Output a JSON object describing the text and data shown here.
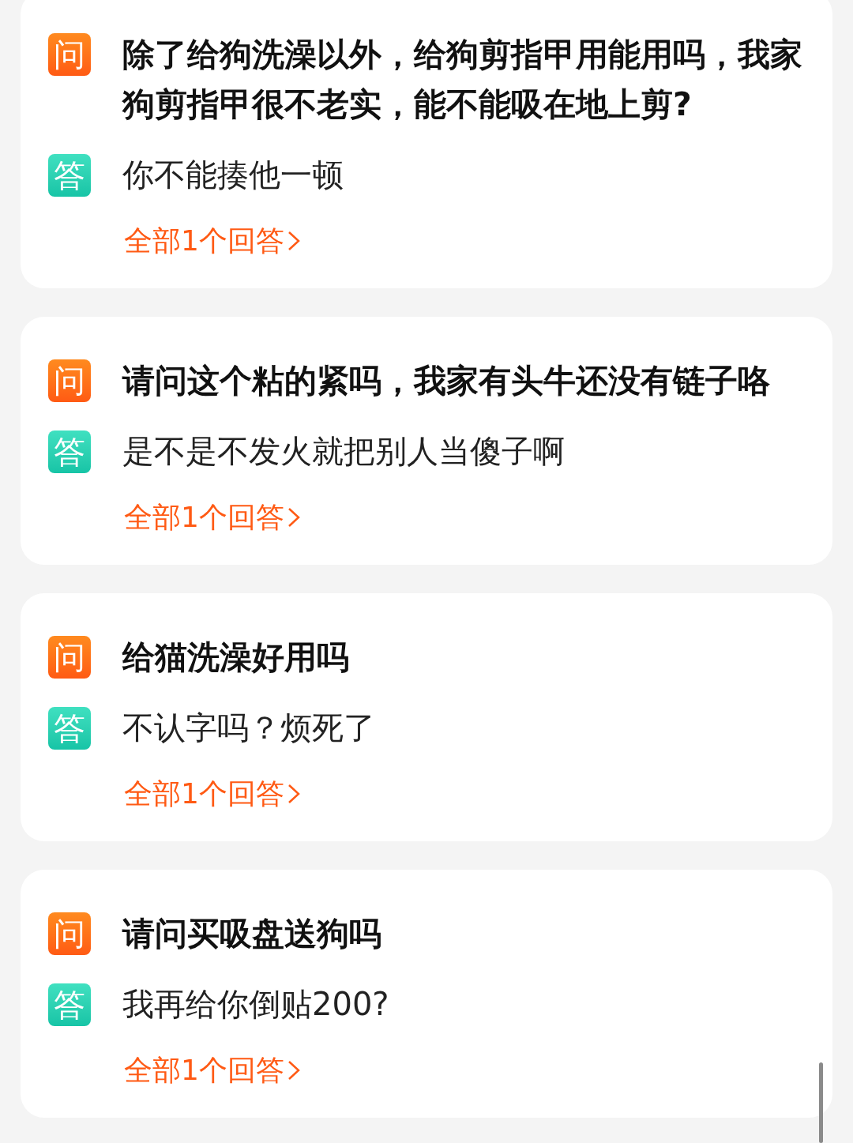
{
  "qa_cards": [
    {
      "question_badge": "问",
      "question": "除了给狗洗澡以外，给狗剪指甲用能用吗，我家狗剪指甲很不老实，能不能吸在地上剪?",
      "answer_badge": "答",
      "answer": "你不能揍他一顿",
      "all_answers_link": "全部1个回答"
    },
    {
      "question_badge": "问",
      "question": "请问这个粘的紧吗，我家有头牛还没有链子咯",
      "answer_badge": "答",
      "answer": "是不是不发火就把别人当傻子啊",
      "all_answers_link": "全部1个回答"
    },
    {
      "question_badge": "问",
      "question": "给猫洗澡好用吗",
      "answer_badge": "答",
      "answer": "不认字吗？烦死了",
      "all_answers_link": "全部1个回答"
    },
    {
      "question_badge": "问",
      "question": "请问买吸盘送狗吗",
      "answer_badge": "答",
      "answer": "我再给你倒贴200?",
      "all_answers_link": "全部1个回答"
    }
  ]
}
